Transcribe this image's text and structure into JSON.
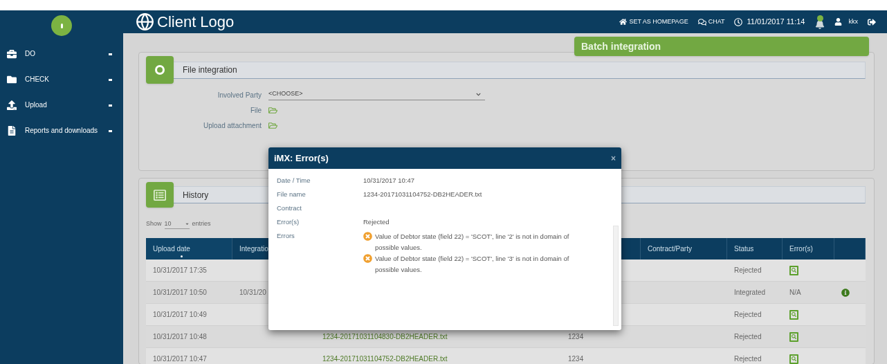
{
  "sidebar": {
    "items": [
      {
        "label": "DO"
      },
      {
        "label": "CHECK"
      },
      {
        "label": "Upload"
      },
      {
        "label": "Reports and downloads"
      }
    ]
  },
  "header": {
    "logo": "Client Logo",
    "links": [
      "SET AS HOMEPAGE",
      "CHAT"
    ],
    "datetime": "11/01/2017 11:14",
    "user": "kkx"
  },
  "banner": "Batch integration",
  "file_integration": {
    "title": "File integration",
    "fields": [
      {
        "label": "Involved Party",
        "kind": "select",
        "value": "<CHOOSE>"
      },
      {
        "label": "File",
        "kind": "folder"
      },
      {
        "label": "Upload attachment",
        "kind": "folder"
      }
    ]
  },
  "history": {
    "title": "History",
    "show": "Show",
    "page_size": "10",
    "entries": "entries",
    "columns": [
      {
        "label": "Upload date",
        "sorted": true
      },
      {
        "label": "Integratio",
        "sorted": false
      },
      {},
      {},
      {
        "label": "Contract/Party",
        "sorted": false
      },
      {
        "label": "Status",
        "sorted": false
      },
      {
        "label": "Error(s)",
        "sorted": false
      },
      {}
    ],
    "rows": [
      {
        "upload_date": "10/31/2017 17:35",
        "integration": "",
        "file": "",
        "contract": "",
        "status": "Rejected",
        "errors": {
          "kind": "view"
        },
        "info": false
      },
      {
        "upload_date": "10/31/2017 10:50",
        "integration": "10/31/20",
        "file": "",
        "contract": "",
        "status": "Integrated",
        "errors": {
          "kind": "text",
          "text": "N/A"
        },
        "info": true
      },
      {
        "upload_date": "10/31/2017 10:49",
        "integration": "",
        "file": "",
        "contract": "",
        "status": "Rejected",
        "errors": {
          "kind": "view"
        },
        "info": false
      },
      {
        "upload_date": "10/31/2017 10:48",
        "integration": "",
        "file": "1234-20171031104830-DB2HEADER.txt",
        "contract": "1234",
        "status": "Rejected",
        "errors": {
          "kind": "view"
        },
        "info": false
      },
      {
        "upload_date": "10/31/2017 10:47",
        "integration": "",
        "file": "1234-20171031104752-DB2HEADER.txt",
        "contract": "1234",
        "status": "Rejected",
        "errors": {
          "kind": "view"
        },
        "info": false
      }
    ]
  },
  "modal": {
    "title": "iMX: Error(s)",
    "close": "×",
    "fields": [
      {
        "label": "Date / Time",
        "value": "10/31/2017 10:47"
      },
      {
        "label": "File name",
        "value": "1234-20171031104752-DB2HEADER.txt"
      },
      {
        "label": "Contract"
      },
      {
        "label": "Error(s)",
        "value": "Rejected"
      },
      {
        "label": "Errors"
      }
    ],
    "errors": [
      "Value of Debtor state (field 22) = 'SCOT', line '2' is not in domain of possible values.",
      "Value of Debtor state (field 22) = 'SCOT', line '3' is not in domain of possible values."
    ]
  }
}
